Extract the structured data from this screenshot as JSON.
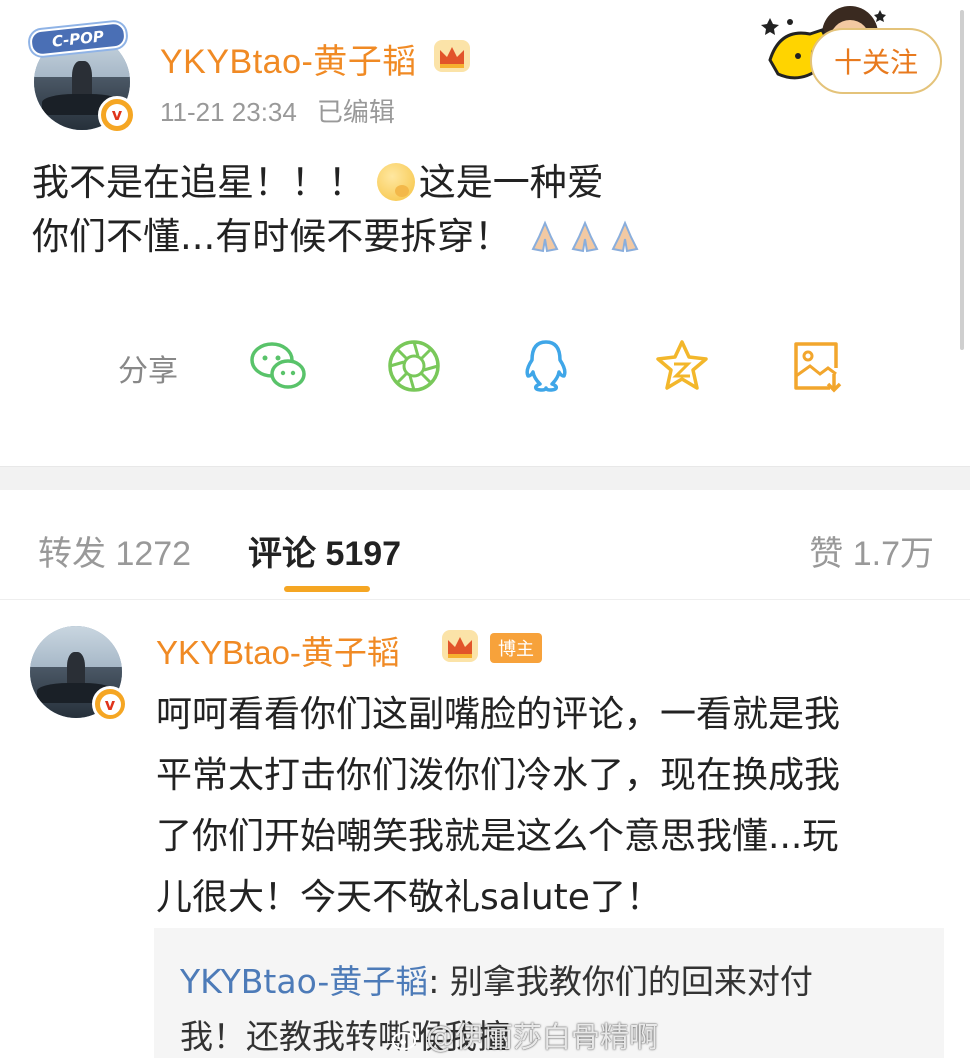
{
  "post": {
    "avatar_sticker": "C-POP",
    "author": "YKYBtao-黄子韬",
    "timestamp": "11-21 23:34",
    "edited_label": "已编辑",
    "follow_label": "十关注",
    "text_lines": [
      "我不是在追星！！！",
      "这是一种爱",
      "你们不懂...有时候不要拆穿！"
    ],
    "share_label": "分享",
    "share_icons": [
      "wechat-icon",
      "moments-icon",
      "qq-icon",
      "qzone-icon",
      "save-image-icon"
    ]
  },
  "tabs": {
    "repost_label": "转发 1272",
    "comments_label": "评论 5197",
    "likes_label": "赞 1.7万"
  },
  "comment": {
    "author": "YKYBtao-黄子韬",
    "badge": "博主",
    "text_lines": [
      "呵呵看看你们这副嘴脸的评论，一看就是我",
      "平常太打击你们泼你们冷水了，现在换成我",
      "了你们开始嘲笑我就是这么个意思我懂...玩",
      "儿很大！今天不敬礼salute了！"
    ],
    "reply": {
      "author": "YKYBtao-黄子韬",
      "text_line1": ": 别拿我教你们的回来对付",
      "text_line2": "我！还教我转嘶喉我擅"
    }
  },
  "watermark": "@伊丽莎白骨精啊",
  "colors": {
    "accent": "#f08a24",
    "tab_underline": "#f5a623",
    "reply_author": "#4d7bb8",
    "share_icons": "#59c36a"
  }
}
